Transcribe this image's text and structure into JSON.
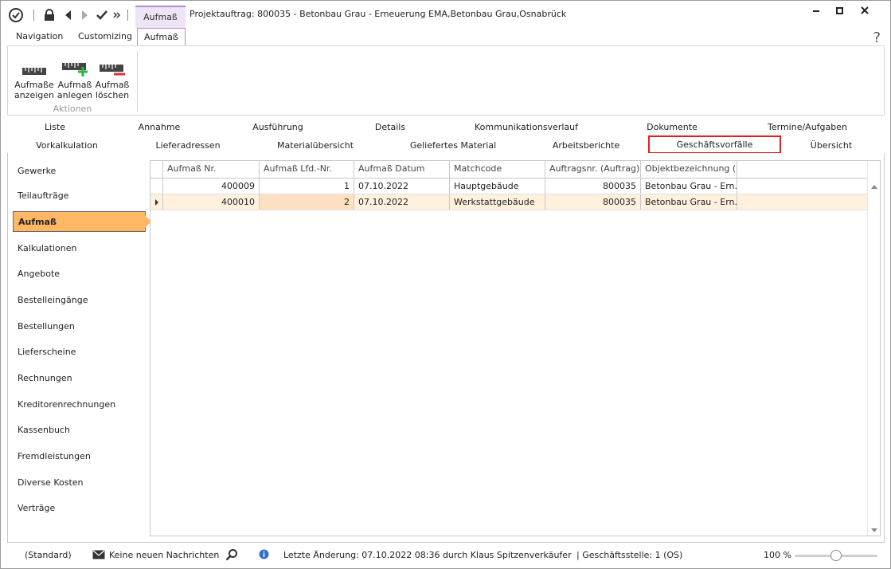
{
  "window": {
    "title": "Projektauftrag: 800035 - Betonbau Grau - Erneuerung EMA,Betonbau Grau,Osnabrück",
    "context_tab": "Aufmaß"
  },
  "ribbon": {
    "tabs": [
      {
        "label": "Navigation"
      },
      {
        "label": "Customizing"
      },
      {
        "label": "Aufmaß"
      }
    ],
    "help": "?",
    "group_label": "Aktionen",
    "buttons": [
      {
        "line1": "Aufmaße",
        "line2": "anzeigen"
      },
      {
        "line1": "Aufmaß",
        "line2": "anlegen"
      },
      {
        "line1": "Aufmaß",
        "line2": "löschen"
      }
    ]
  },
  "tabs": {
    "row1": [
      "Liste",
      "Annahme",
      "Ausführung",
      "Details",
      "Kommunikationsverlauf",
      "Dokumente",
      "Termine/Aufgaben"
    ],
    "row2": [
      "Vorkalkulation",
      "Lieferadressen",
      "Materialübersicht",
      "Geliefertes Material",
      "Arbeitsberichte",
      "Geschäftsvorfälle",
      "Übersicht"
    ]
  },
  "nav": {
    "items": [
      "Gewerke",
      "Teilaufträge",
      "Aufmaß",
      "Kalkulationen",
      "Angebote",
      "Bestelleingänge",
      "Bestellungen",
      "Lieferscheine",
      "Rechnungen",
      "Kreditorenrechnungen",
      "Kassenbuch",
      "Fremdleistungen",
      "Diverse Kosten",
      "Verträge"
    ],
    "active": "Aufmaß"
  },
  "grid": {
    "columns": [
      "Aufmaß Nr.",
      "Aufmaß Lfd.-Nr.",
      "Aufmaß Datum",
      "Matchcode",
      "Auftragsnr. (Auftrag)",
      "Objektbezeichnung (..."
    ],
    "rows": [
      [
        "400009",
        "1",
        "07.10.2022",
        "Hauptgebäude",
        "800035",
        "Betonbau Grau - Ern..."
      ],
      [
        "400010",
        "2",
        "07.10.2022",
        "Werkstattgebäude",
        "800035",
        "Betonbau Grau - Ern..."
      ]
    ]
  },
  "status": {
    "layout": "(Standard)",
    "messages": "Keine neuen Nachrichten",
    "last_change": "Letzte Änderung: 07.10.2022 08:36 durch Klaus Spitzenverkäufer",
    "branch": "| Geschäftsstelle:  1 (OS)",
    "zoom": "100 %",
    "zoom_level": 100
  },
  "colors": {
    "active_nav": "#ffb764",
    "selected_row": "#fff1de",
    "selected_tab_border": "#e02020",
    "context_accent": "#b48ad3",
    "info_icon": "#2f6fd6",
    "add_icon": "#2fb24c",
    "delete_icon": "#e0343a"
  }
}
